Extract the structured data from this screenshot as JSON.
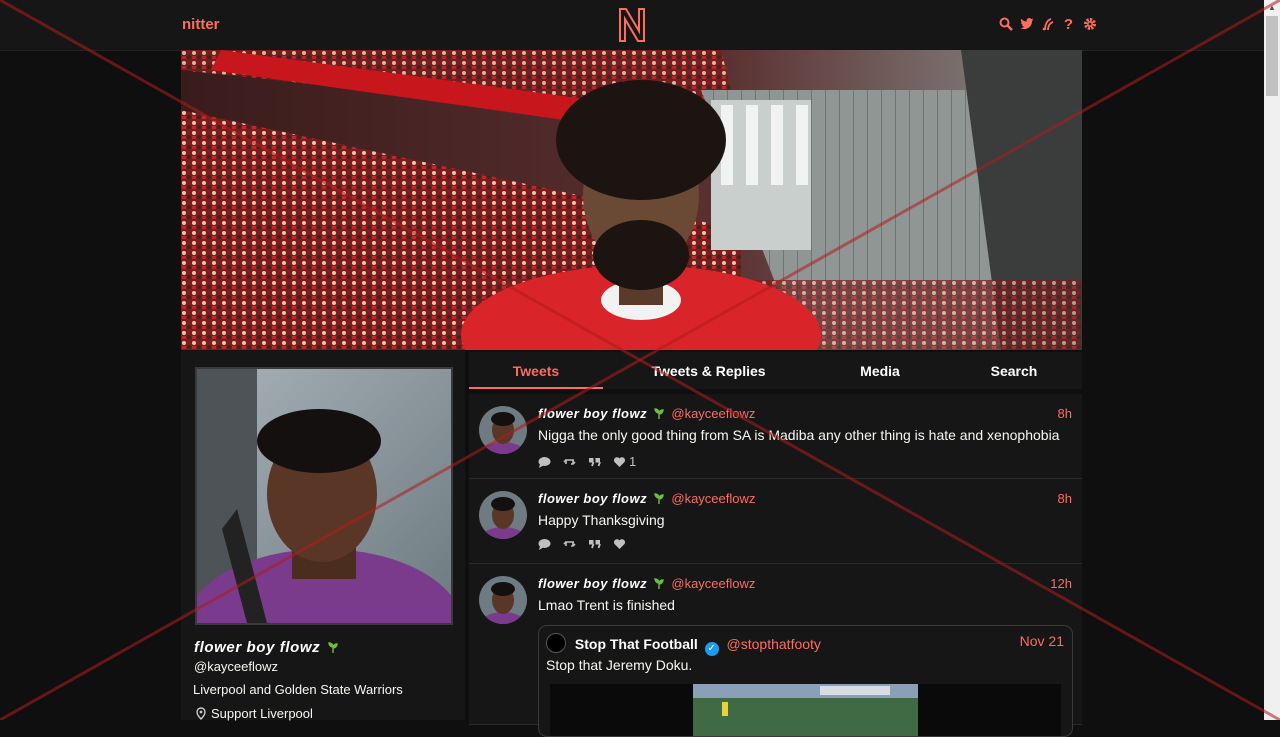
{
  "navbar": {
    "brand": "nitter",
    "logo_letter": "N",
    "icons": [
      "search-icon",
      "twitter-bird-icon",
      "rss-icon",
      "help-icon",
      "gear-icon"
    ],
    "help_glyph": "?"
  },
  "colors": {
    "accent": "#ff6c60",
    "background": "#0f0f0f",
    "card": "#161616",
    "text": "#f8f8f2"
  },
  "profile": {
    "fullname": "flower boy flowz",
    "username": "@kayceeflowz",
    "bio": "Liverpool and Golden State Warriors",
    "location": "Support Liverpool"
  },
  "tabs": [
    {
      "label": "Tweets",
      "active": true
    },
    {
      "label": "Tweets & Replies",
      "active": false
    },
    {
      "label": "Media",
      "active": false
    },
    {
      "label": "Search",
      "active": false
    }
  ],
  "tweets": [
    {
      "fullname": "flower boy flowz",
      "username": "@kayceeflowz",
      "date": "8h",
      "text": "Nigga the only good thing from SA is Madiba any other thing is hate and xenophobia",
      "likes": "1"
    },
    {
      "fullname": "flower boy flowz",
      "username": "@kayceeflowz",
      "date": "8h",
      "text": "Happy Thanksgiving",
      "likes": ""
    },
    {
      "fullname": "flower boy flowz",
      "username": "@kayceeflowz",
      "date": "12h",
      "text": "Lmao Trent is finished",
      "quote": {
        "fullname": "Stop That Football",
        "username": "@stopthatfooty",
        "date": "Nov 21",
        "text": "Stop that Jeremy Doku."
      }
    }
  ]
}
